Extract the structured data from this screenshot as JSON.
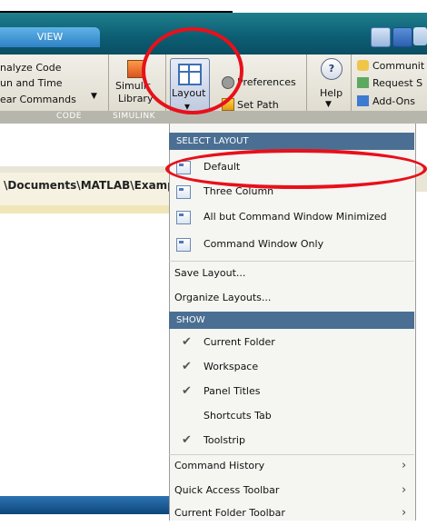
{
  "tabs": {
    "view": "VIEW"
  },
  "ribbon": {
    "code_group": {
      "analyze_code": "nalyze Code",
      "run_and_time": "un and Time",
      "clear_commands": "ear Commands",
      "label": "CODE"
    },
    "simulink": {
      "line1": "Simulir",
      "line2": "Library",
      "label": "SIMULINK"
    },
    "layout": {
      "label": "Layout",
      "dropdown": "▾"
    },
    "environment": {
      "preferences": "Preferences",
      "set_path": "Set Path"
    },
    "help": {
      "label": "Help"
    },
    "resources": {
      "community": "Communit",
      "request_support": "Request S",
      "add_ons": "Add-Ons"
    }
  },
  "path_bar": {
    "path": "\\Documents\\MATLAB\\Examp"
  },
  "menu": {
    "select_layout_header": "SELECT LAYOUT",
    "layouts": [
      {
        "label": "Default"
      },
      {
        "label": "Three Column"
      },
      {
        "label": "All but Command Window Minimized"
      },
      {
        "label": "Command Window Only"
      }
    ],
    "save_layout": "Save Layout...",
    "organize_layouts": "Organize Layouts...",
    "show_header": "SHOW",
    "show_items": [
      {
        "label": "Current Folder",
        "checked": true
      },
      {
        "label": "Workspace",
        "checked": true
      },
      {
        "label": "Panel Titles",
        "checked": true
      },
      {
        "label": "Shortcuts Tab",
        "checked": false
      },
      {
        "label": "Toolstrip",
        "checked": true
      }
    ],
    "submenus": [
      {
        "label": "Command History"
      },
      {
        "label": "Quick Access Toolbar"
      },
      {
        "label": "Current Folder Toolbar"
      }
    ]
  },
  "colors": {
    "highlight_annotation": "#e8101a",
    "menu_header": "#4b6f93",
    "tab_bar": "#0d5f74"
  }
}
